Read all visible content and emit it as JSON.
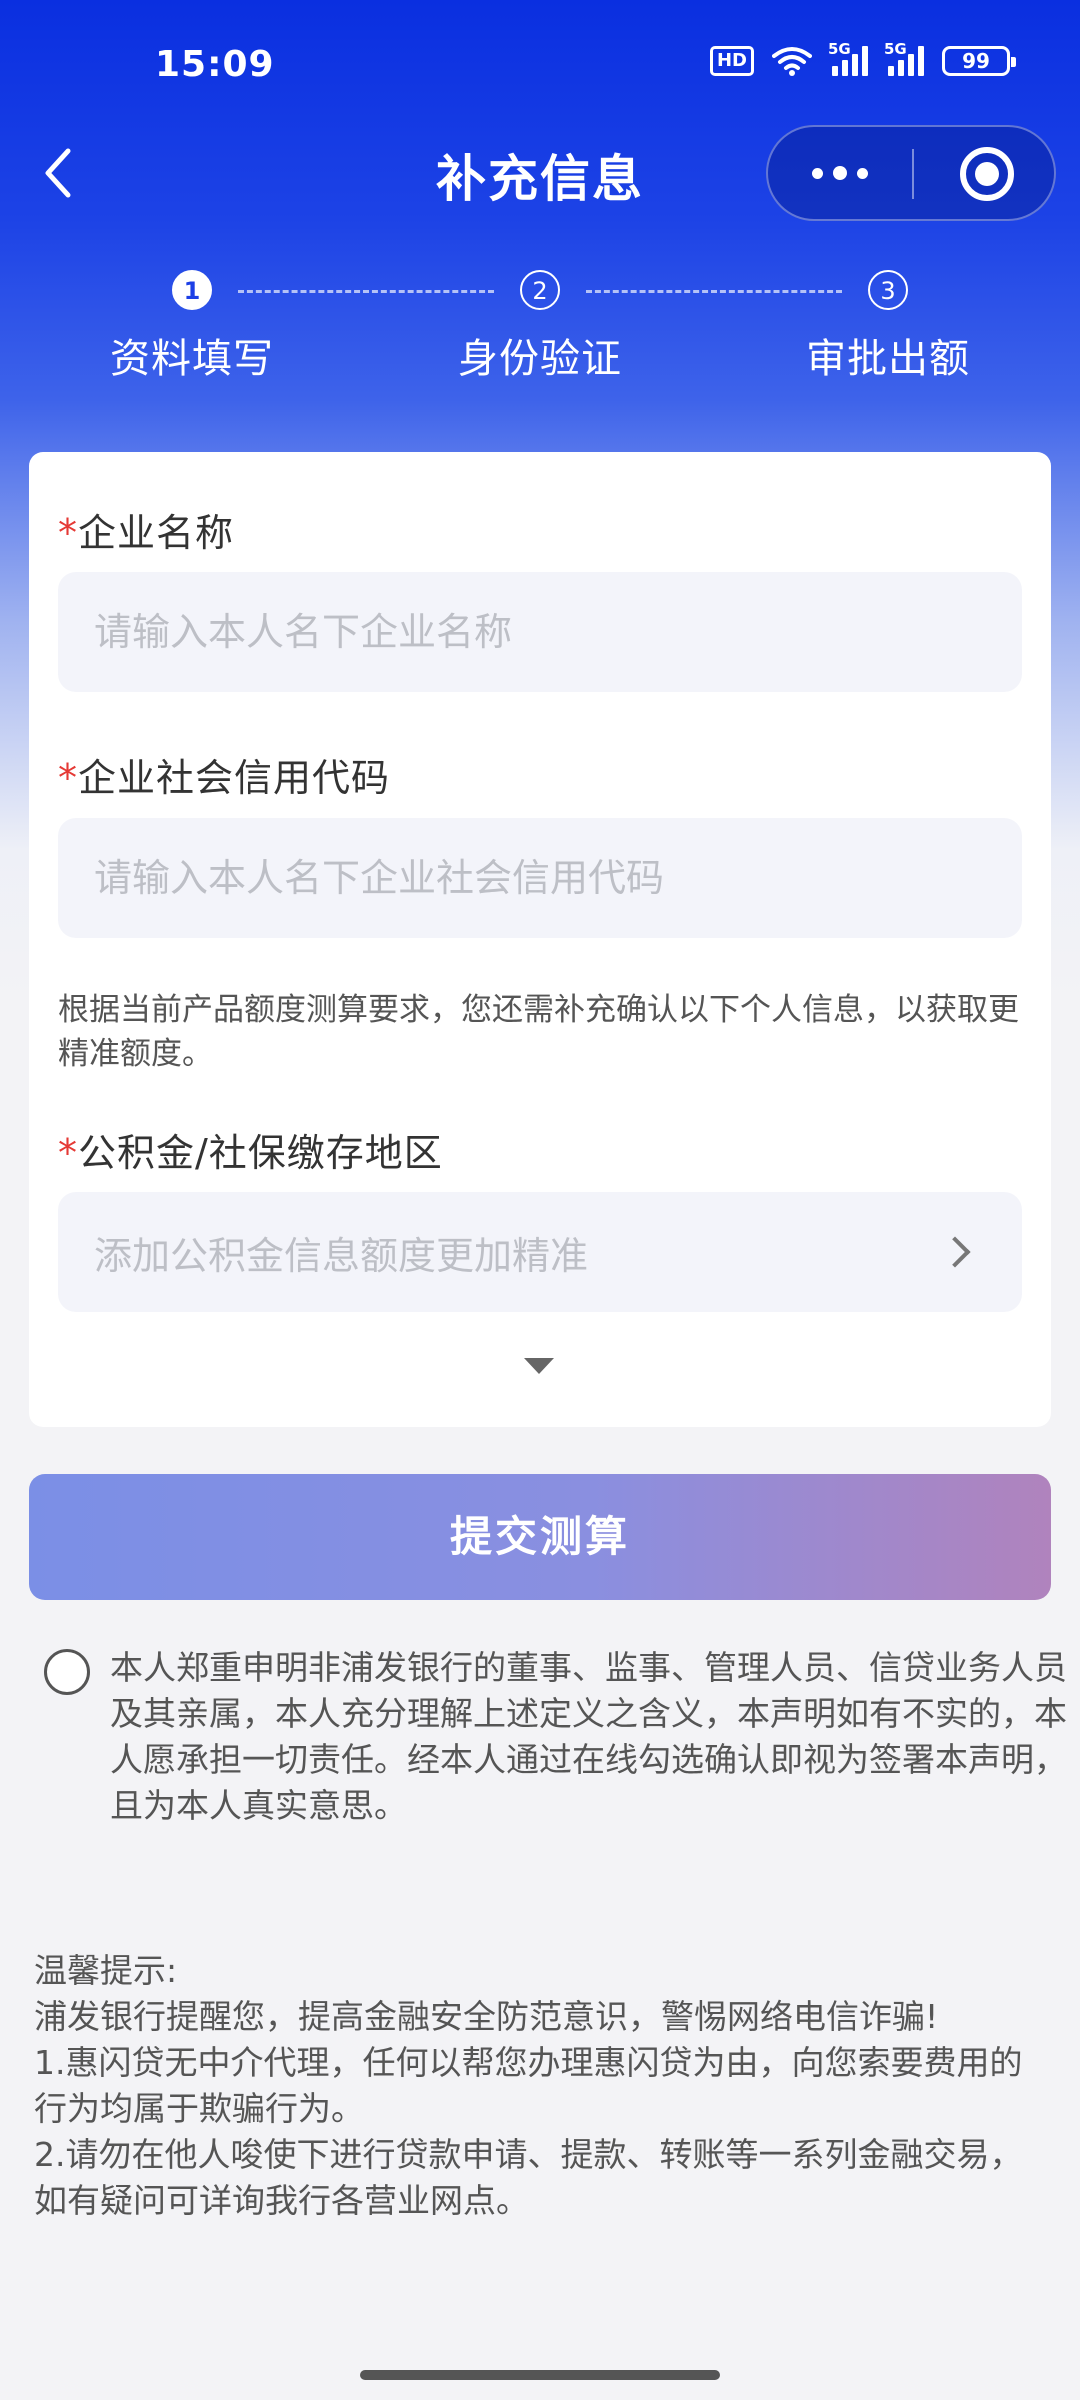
{
  "status_bar": {
    "time": "15:09",
    "hd_label": "HD",
    "signal1_label": "5G",
    "signal2_label": "5G",
    "battery": "99"
  },
  "nav": {
    "title": "补充信息",
    "back_icon": "chevron-left-icon",
    "more_icon": "more-dots-icon",
    "close_icon": "target-circle-icon"
  },
  "steps": [
    {
      "num": "1",
      "label": "资料填写",
      "active": true
    },
    {
      "num": "2",
      "label": "身份验证",
      "active": false
    },
    {
      "num": "3",
      "label": "审批出额",
      "active": false
    }
  ],
  "form": {
    "required_mark": "*",
    "company_name": {
      "label": "企业名称",
      "placeholder": "请输入本人名下企业名称",
      "value": ""
    },
    "credit_code": {
      "label": "企业社会信用代码",
      "placeholder": "请输入本人名下企业社会信用代码",
      "value": ""
    },
    "hint": "根据当前产品额度测算要求，您还需补充确认以下个人信息，以获取更精准额度。",
    "fund_region": {
      "label": "公积金/社保缴存地区",
      "placeholder": "添加公积金信息额度更加精准"
    }
  },
  "submit_label": "提交测算",
  "consent": {
    "checked": false,
    "text": "本人郑重申明非浦发银行的董事、监事、管理人员、信贷业务人员及其亲属，本人充分理解上述定义之含义，本声明如有不实的，本人愿承担一切责任。经本人通过在线勾选确认即视为签署本声明，且为本人真实意思。"
  },
  "tips": {
    "title": "温馨提示:",
    "line1": "浦发银行提醒您，提高金融安全防范意识，警惕网络电信诈骗!",
    "line2": "1.惠闪贷无中介代理，任何以帮您办理惠闪贷为由，向您索要费用的行为均属于欺骗行为。",
    "line3": "2.请勿在他人唆使下进行贷款申请、提款、转账等一系列金融交易，如有疑问可详询我行各营业网点。"
  }
}
